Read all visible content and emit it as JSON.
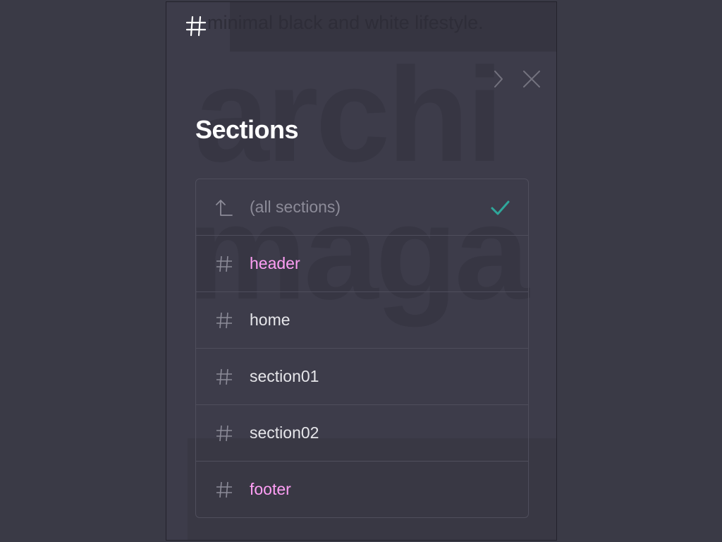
{
  "background": {
    "tagline": "minimal black and white lifestyle.",
    "word1": "archi",
    "word2": "maga"
  },
  "toolbar": {
    "logo_icon": "hash-icon",
    "next_icon": "chevron-right-icon",
    "close_icon": "close-icon"
  },
  "panel": {
    "title": "Sections",
    "items": [
      {
        "label": "(all sections)",
        "icon": "up-arrow-icon",
        "selected": true
      },
      {
        "label": "header",
        "icon": "hash-icon",
        "selected": false
      },
      {
        "label": "home",
        "icon": "hash-icon",
        "selected": false
      },
      {
        "label": "section01",
        "icon": "hash-icon",
        "selected": false
      },
      {
        "label": "section02",
        "icon": "hash-icon",
        "selected": false
      },
      {
        "label": "footer",
        "icon": "hash-icon",
        "selected": false
      }
    ]
  },
  "colors": {
    "page_bg": "#3a3a46",
    "panel_bg": "#3d3c4a",
    "accent_check": "#2fa79b",
    "highlight_pink": "#ff9ff5",
    "text_primary": "#e6e6ea",
    "text_muted": "#8c8b98"
  }
}
